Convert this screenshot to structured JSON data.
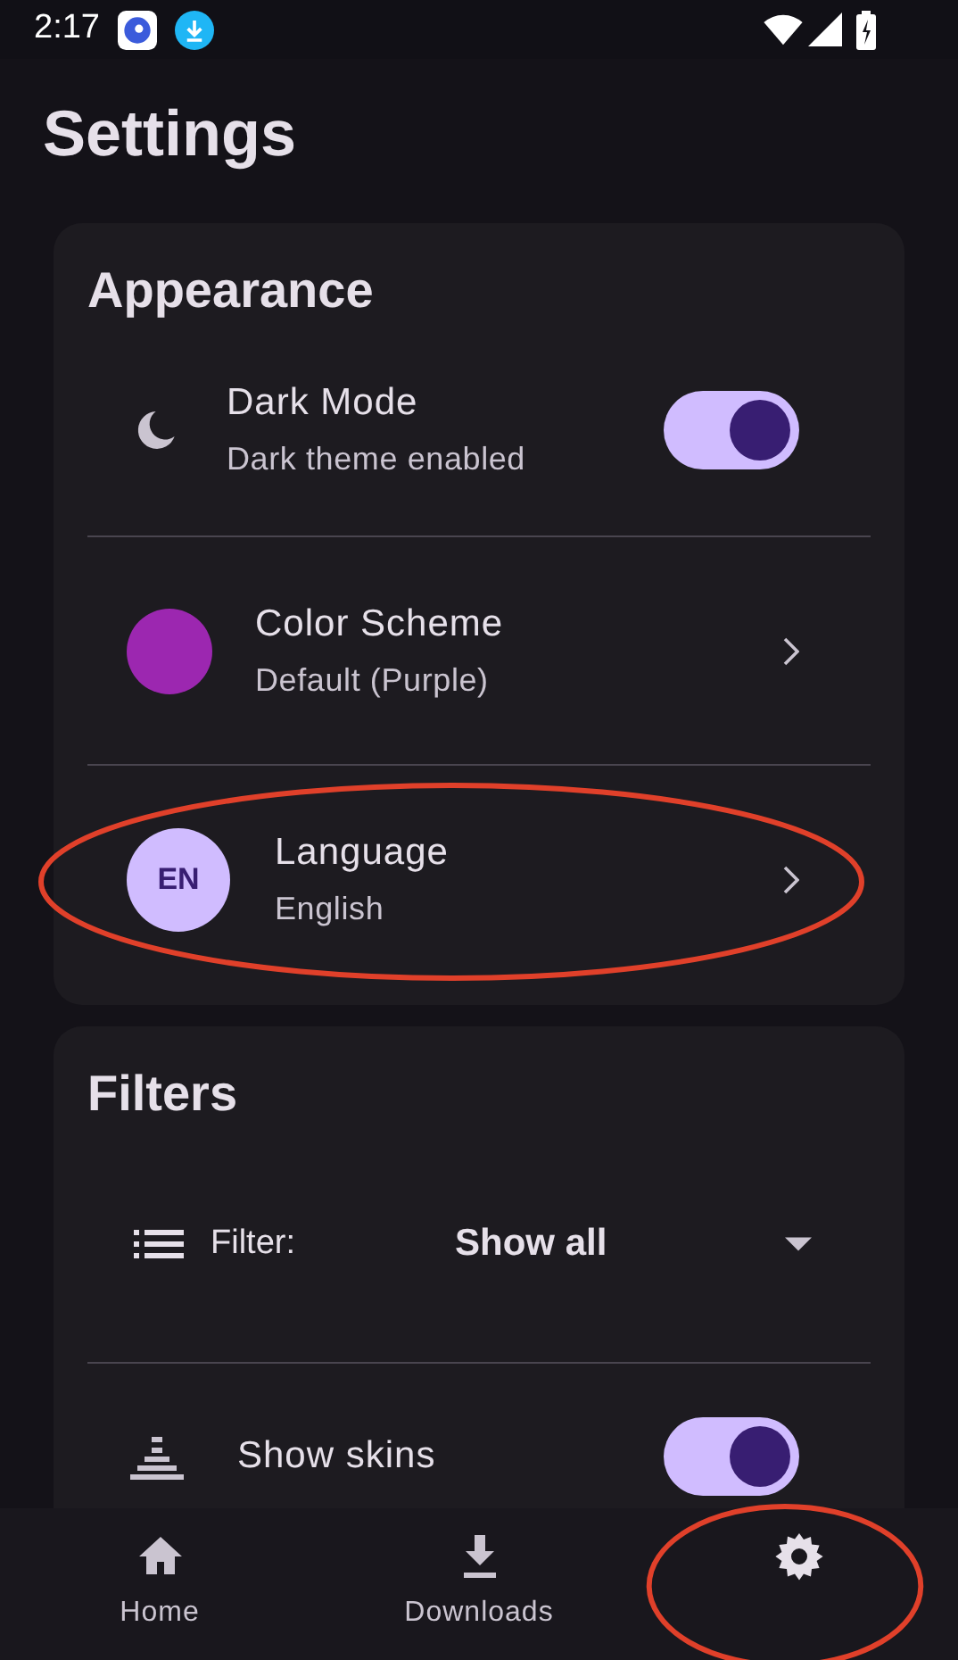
{
  "status_bar": {
    "time": "2:17"
  },
  "title": "Settings",
  "sections": [
    {
      "title": "Appearance",
      "items": [
        {
          "kind": "switch",
          "label": "Dark Mode",
          "subtitle": "Dark theme enabled",
          "on": true
        },
        {
          "kind": "color",
          "label": "Color Scheme",
          "subtitle": "Default (Purple)",
          "color": "#9c27b0"
        },
        {
          "kind": "badge",
          "badge": "EN",
          "label": "Language",
          "subtitle": "English"
        }
      ]
    },
    {
      "title": "Filters",
      "items": [
        {
          "kind": "dropdown",
          "label": "Filter:",
          "value": "Show all"
        },
        {
          "kind": "switch",
          "label": "Show skins",
          "on": true
        }
      ]
    }
  ],
  "nav": [
    {
      "kind": "home",
      "label": "Home",
      "selected": false
    },
    {
      "kind": "download",
      "label": "Downloads",
      "selected": false
    },
    {
      "kind": "settings",
      "selected": true
    }
  ]
}
